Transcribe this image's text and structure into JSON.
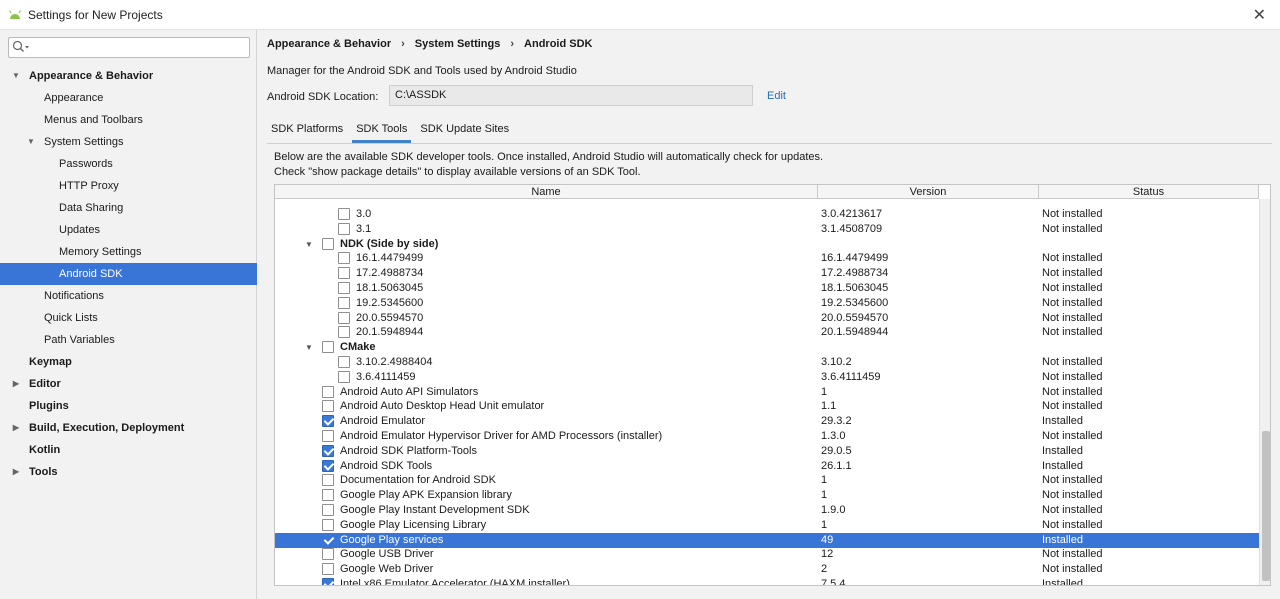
{
  "window": {
    "title": "Settings for New Projects",
    "close_icon": "close-icon"
  },
  "sidebar": {
    "search_placeholder": "",
    "items": [
      {
        "label": "Appearance & Behavior",
        "level": 0,
        "bold": true,
        "expanded": true
      },
      {
        "label": "Appearance",
        "level": 1
      },
      {
        "label": "Menus and Toolbars",
        "level": 1
      },
      {
        "label": "System Settings",
        "level": 1,
        "expanded": true
      },
      {
        "label": "Passwords",
        "level": 2
      },
      {
        "label": "HTTP Proxy",
        "level": 2
      },
      {
        "label": "Data Sharing",
        "level": 2
      },
      {
        "label": "Updates",
        "level": 2
      },
      {
        "label": "Memory Settings",
        "level": 2
      },
      {
        "label": "Android SDK",
        "level": 2,
        "selected": true
      },
      {
        "label": "Notifications",
        "level": 1
      },
      {
        "label": "Quick Lists",
        "level": 1
      },
      {
        "label": "Path Variables",
        "level": 1
      },
      {
        "label": "Keymap",
        "level": 0,
        "bold": true
      },
      {
        "label": "Editor",
        "level": 0,
        "bold": true,
        "collapsed": true
      },
      {
        "label": "Plugins",
        "level": 0,
        "bold": true
      },
      {
        "label": "Build, Execution, Deployment",
        "level": 0,
        "bold": true,
        "collapsed": true
      },
      {
        "label": "Kotlin",
        "level": 0,
        "bold": true
      },
      {
        "label": "Tools",
        "level": 0,
        "bold": true,
        "collapsed": true
      }
    ]
  },
  "breadcrumb": [
    "Appearance & Behavior",
    "System Settings",
    "Android SDK"
  ],
  "description": "Manager for the Android SDK and Tools used by Android Studio",
  "sdk_location": {
    "label": "Android SDK Location:",
    "value": "C:\\ASSDK",
    "edit_label": "Edit"
  },
  "tabs": [
    {
      "label": "SDK Platforms",
      "active": false
    },
    {
      "label": "SDK Tools",
      "active": true
    },
    {
      "label": "SDK Update Sites",
      "active": false
    }
  ],
  "info_lines": [
    "Below are the available SDK developer tools. Once installed, Android Studio will automatically check for updates.",
    "Check \"show package details\" to display available versions of an SDK Tool."
  ],
  "table": {
    "columns": [
      "Name",
      "Version",
      "Status"
    ],
    "rows": [
      {
        "name": "3.0",
        "version": "3.0.4213617",
        "status": "Not installed",
        "indent": 2,
        "checked": false
      },
      {
        "name": "3.1",
        "version": "3.1.4508709",
        "status": "Not installed",
        "indent": 2,
        "checked": false
      },
      {
        "name": "NDK (Side by side)",
        "version": "",
        "status": "",
        "indent": 1,
        "checked": false,
        "group": true
      },
      {
        "name": "16.1.4479499",
        "version": "16.1.4479499",
        "status": "Not installed",
        "indent": 2,
        "checked": false
      },
      {
        "name": "17.2.4988734",
        "version": "17.2.4988734",
        "status": "Not installed",
        "indent": 2,
        "checked": false
      },
      {
        "name": "18.1.5063045",
        "version": "18.1.5063045",
        "status": "Not installed",
        "indent": 2,
        "checked": false
      },
      {
        "name": "19.2.5345600",
        "version": "19.2.5345600",
        "status": "Not installed",
        "indent": 2,
        "checked": false
      },
      {
        "name": "20.0.5594570",
        "version": "20.0.5594570",
        "status": "Not installed",
        "indent": 2,
        "checked": false
      },
      {
        "name": "20.1.5948944",
        "version": "20.1.5948944",
        "status": "Not installed",
        "indent": 2,
        "checked": false
      },
      {
        "name": "CMake",
        "version": "",
        "status": "",
        "indent": 1,
        "checked": false,
        "group": true
      },
      {
        "name": "3.10.2.4988404",
        "version": "3.10.2",
        "status": "Not installed",
        "indent": 2,
        "checked": false
      },
      {
        "name": "3.6.4111459",
        "version": "3.6.4111459",
        "status": "Not installed",
        "indent": 2,
        "checked": false
      },
      {
        "name": "Android Auto API Simulators",
        "version": "1",
        "status": "Not installed",
        "indent": 0,
        "checked": false
      },
      {
        "name": "Android Auto Desktop Head Unit emulator",
        "version": "1.1",
        "status": "Not installed",
        "indent": 0,
        "checked": false
      },
      {
        "name": "Android Emulator",
        "version": "29.3.2",
        "status": "Installed",
        "indent": 0,
        "checked": true
      },
      {
        "name": "Android Emulator Hypervisor Driver for AMD Processors (installer)",
        "version": "1.3.0",
        "status": "Not installed",
        "indent": 0,
        "checked": false
      },
      {
        "name": "Android SDK Platform-Tools",
        "version": "29.0.5",
        "status": "Installed",
        "indent": 0,
        "checked": true
      },
      {
        "name": "Android SDK Tools",
        "version": "26.1.1",
        "status": "Installed",
        "indent": 0,
        "checked": true
      },
      {
        "name": "Documentation for Android SDK",
        "version": "1",
        "status": "Not installed",
        "indent": 0,
        "checked": false
      },
      {
        "name": "Google Play APK Expansion library",
        "version": "1",
        "status": "Not installed",
        "indent": 0,
        "checked": false
      },
      {
        "name": "Google Play Instant Development SDK",
        "version": "1.9.0",
        "status": "Not installed",
        "indent": 0,
        "checked": false
      },
      {
        "name": "Google Play Licensing Library",
        "version": "1",
        "status": "Not installed",
        "indent": 0,
        "checked": false
      },
      {
        "name": "Google Play services",
        "version": "49",
        "status": "Installed",
        "indent": 0,
        "checked": true,
        "selected": true
      },
      {
        "name": "Google USB Driver",
        "version": "12",
        "status": "Not installed",
        "indent": 0,
        "checked": false
      },
      {
        "name": "Google Web Driver",
        "version": "2",
        "status": "Not installed",
        "indent": 0,
        "checked": false
      },
      {
        "name": "Intel x86 Emulator Accelerator (HAXM installer)",
        "version": "7.5.4",
        "status": "Installed",
        "indent": 0,
        "checked": true
      }
    ]
  },
  "colors": {
    "selection": "#3875d7",
    "link": "#2470b3",
    "checkbox_on": "#3a7ad4"
  }
}
